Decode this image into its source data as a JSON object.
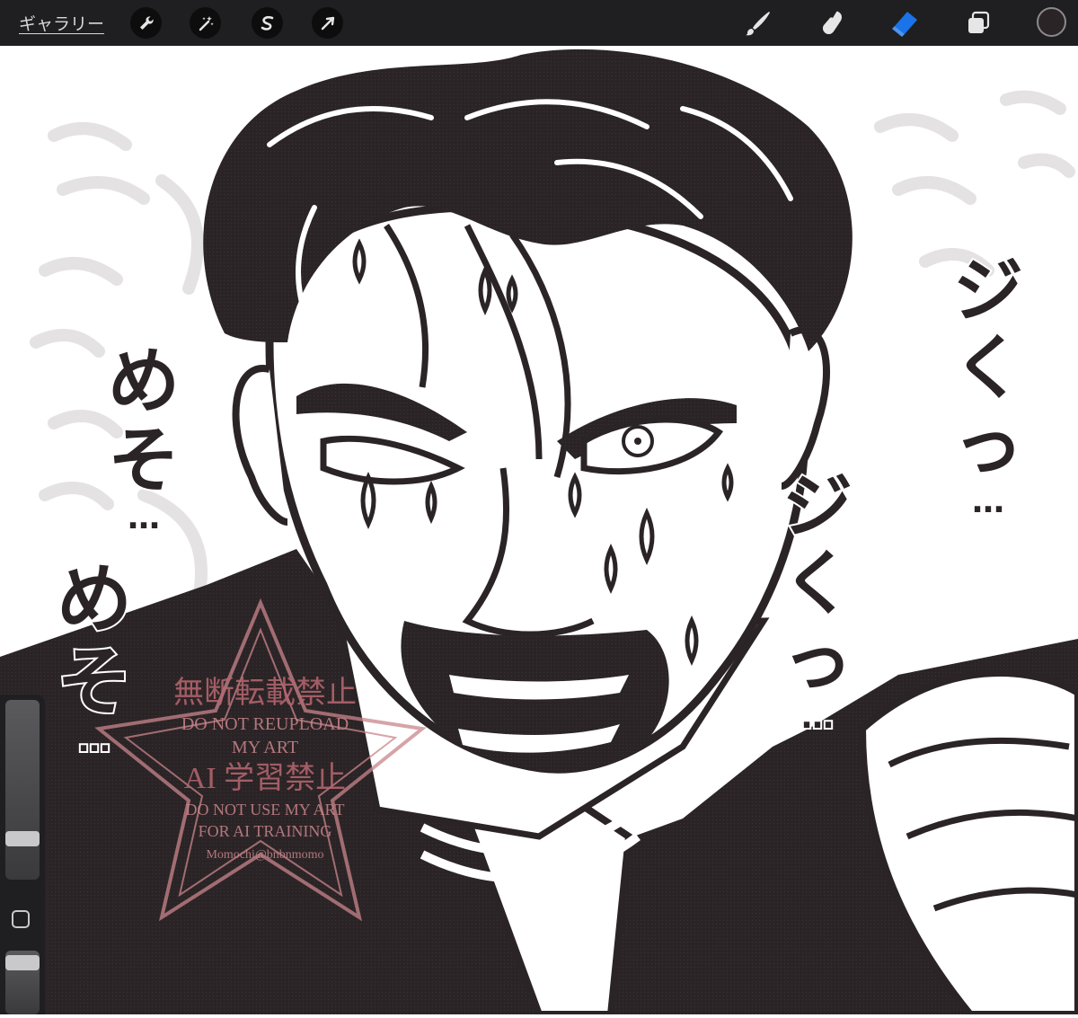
{
  "toolbar": {
    "gallery_label": "ギャラリー",
    "left_tools": [
      {
        "name": "actions",
        "icon": "wrench-icon"
      },
      {
        "name": "adjustments",
        "icon": "magic-wand-icon"
      },
      {
        "name": "selection",
        "icon": "selection-s-icon"
      },
      {
        "name": "transform",
        "icon": "arrow-cursor-icon"
      }
    ],
    "right_tools": [
      {
        "name": "brush",
        "icon": "brush-icon",
        "active": false
      },
      {
        "name": "smudge",
        "icon": "smudge-finger-icon",
        "active": false
      },
      {
        "name": "eraser",
        "icon": "eraser-icon",
        "active": true
      },
      {
        "name": "layers",
        "icon": "layers-icon",
        "active": false
      }
    ],
    "current_color": "#2b2426",
    "accent_color": "#1a73e8"
  },
  "artwork": {
    "sfx_right": [
      "ジ",
      "く",
      "っ",
      "…",
      "ジ",
      "く",
      "っ",
      "…"
    ],
    "sfx_left": [
      "め",
      "そ",
      "…",
      "め",
      "そ",
      "…"
    ],
    "ink_color": "#2b2426",
    "watermark": {
      "line1": "無断転載禁止",
      "line2": "DO NOT REUPLOAD",
      "line3": "MY ART",
      "line4": "AI 学習禁止",
      "line5": "DO NOT USE MY ART",
      "line6": "FOR AI TRAINING",
      "line7": "Momochi@bnbnmomo",
      "color": "#c9868c"
    }
  },
  "sidebar": {
    "brush_size_level": 0.2,
    "opacity_level": 0.9,
    "modify_button": "square-icon"
  }
}
